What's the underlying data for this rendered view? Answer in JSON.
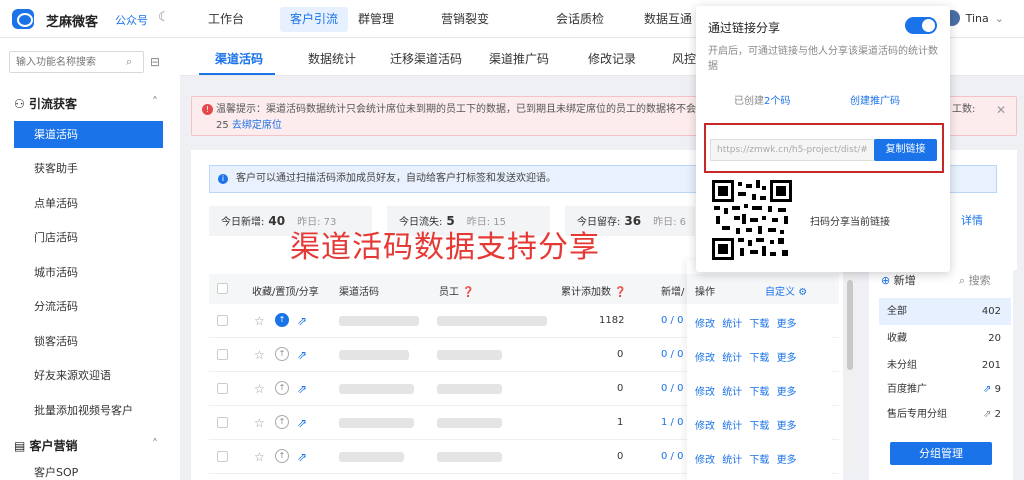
{
  "app": {
    "brand": "芝麻微客",
    "account_type": "公众号"
  },
  "top_nav": [
    "工作台",
    "客户引流",
    "群管理",
    "营销裂变",
    "会话质检",
    "数据互通"
  ],
  "user": {
    "name": "Tina"
  },
  "sidebar": {
    "search_placeholder": "输入功能名称搜索",
    "sections": [
      {
        "title": "引流获客"
      },
      {
        "title": "客户营销"
      }
    ],
    "items": [
      "渠道活码",
      "获客助手",
      "点单活码",
      "门店活码",
      "城市活码",
      "分流活码",
      "锁客活码",
      "好友来源欢迎语",
      "批量添加视频号客户"
    ],
    "last_item": "客户SOP"
  },
  "tabs": [
    "渠道活码",
    "数据统计",
    "迁移渠道活码",
    "渠道推广码",
    "修改记录",
    "风控管理"
  ],
  "alert": {
    "line1": "温馨提示：渠道活码数据统计只会统计席位未到期的员工下的数据，已到期且未绑定席位的员工的数据将不会",
    "line1_end": "工数:",
    "count": "25",
    "link": "去绑定席位"
  },
  "info_tip": "客户可以通过扫描活码添加成员好友，自动给客户打标签和发送欢迎语。",
  "stats": [
    {
      "label": "今日新增:",
      "value": "40",
      "yd_label": "昨日:",
      "yd": "73"
    },
    {
      "label": "今日流失:",
      "value": "5",
      "yd_label": "昨日:",
      "yd": "15"
    },
    {
      "label": "今日留存:",
      "value": "36",
      "yd_label": "昨日:",
      "yd": "6"
    }
  ],
  "detail_link": "详情",
  "overlay_text": "渠道活码数据支持分享",
  "table": {
    "headers": {
      "fav": "收藏/置顶/分享",
      "name": "渠道活码",
      "staff": "员工",
      "total": "累计添加数",
      "new": "新增/"
    },
    "rows": [
      {
        "total": "1182",
        "new": "0 / 0"
      },
      {
        "total": "0",
        "new": "0 / 0"
      },
      {
        "total": "0",
        "new": "0 / 0"
      },
      {
        "total": "1",
        "new": "1 / 0"
      },
      {
        "total": "0",
        "new": "0 / 0"
      }
    ],
    "ops_header": "操作",
    "custom": "自定义",
    "ops": [
      "修改",
      "统计",
      "下载",
      "更多"
    ]
  },
  "groups": {
    "add": "新增",
    "search": "搜索",
    "items": [
      {
        "name": "全部",
        "count": "402"
      },
      {
        "name": "收藏",
        "count": "20"
      },
      {
        "name": "未分组",
        "count": "201"
      },
      {
        "name": "百度推广",
        "count": "9"
      },
      {
        "name": "售后专用分组",
        "count": "2"
      }
    ],
    "manage_button": "分组管理"
  },
  "popup": {
    "title": "通过链接分享",
    "description": "开启后，可通过链接与他人分享该渠道活码的统计数据",
    "created_prefix": "已创建",
    "created_count": "2个码",
    "create_link": "创建推广码",
    "url": "https://zmwk.cn/h5-project/dist/#",
    "copy_button": "复制链接",
    "qr_caption": "扫码分享当前链接"
  },
  "colors": {
    "accent": "#1a73e8",
    "alert_bg": "#fdeced",
    "overlay_red": "#e53935",
    "box_red": "#c62828"
  }
}
